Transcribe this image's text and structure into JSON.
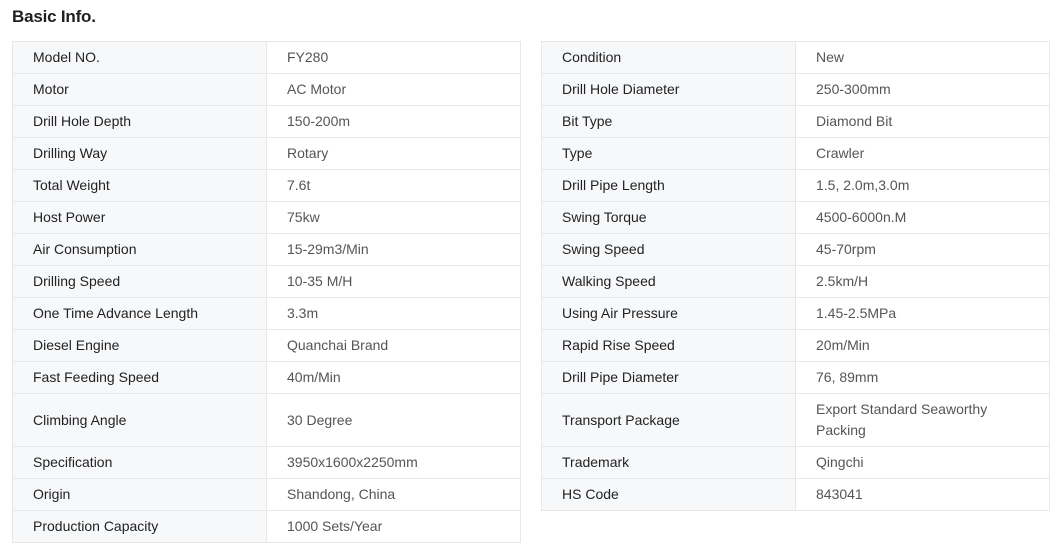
{
  "page": {
    "title": "Basic Info."
  },
  "left_table": {
    "rows": [
      {
        "label": "Model NO.",
        "value": "FY280"
      },
      {
        "label": "Motor",
        "value": "AC Motor"
      },
      {
        "label": "Drill Hole Depth",
        "value": "150-200m"
      },
      {
        "label": "Drilling Way",
        "value": "Rotary"
      },
      {
        "label": "Total Weight",
        "value": "7.6t"
      },
      {
        "label": "Host Power",
        "value": "75kw"
      },
      {
        "label": "Air Consumption",
        "value": "15-29m3/Min"
      },
      {
        "label": "Drilling Speed",
        "value": "10-35 M/H"
      },
      {
        "label": "One Time Advance Length",
        "value": "3.3m"
      },
      {
        "label": "Diesel Engine",
        "value": "Quanchai Brand"
      },
      {
        "label": "Fast Feeding Speed",
        "value": "40m/Min"
      },
      {
        "label": "Climbing Angle",
        "value": "30 Degree"
      },
      {
        "label": "Specification",
        "value": "3950x1600x2250mm"
      },
      {
        "label": "Origin",
        "value": "Shandong, China"
      },
      {
        "label": "Production Capacity",
        "value": "1000 Sets/Year"
      }
    ]
  },
  "right_table": {
    "rows": [
      {
        "label": "Condition",
        "value": "New"
      },
      {
        "label": "Drill Hole Diameter",
        "value": "250-300mm"
      },
      {
        "label": "Bit Type",
        "value": "Diamond Bit"
      },
      {
        "label": "Type",
        "value": "Crawler"
      },
      {
        "label": "Drill Pipe Length",
        "value": "1.5, 2.0m,3.0m"
      },
      {
        "label": "Swing Torque",
        "value": "4500-6000n.M"
      },
      {
        "label": "Swing Speed",
        "value": "45-70rpm"
      },
      {
        "label": "Walking Speed",
        "value": "2.5km/H"
      },
      {
        "label": "Using Air Pressure",
        "value": "1.45-2.5MPa"
      },
      {
        "label": "Rapid Rise Speed",
        "value": "20m/Min"
      },
      {
        "label": "Drill Pipe Diameter",
        "value": "76, 89mm"
      },
      {
        "label": "Transport Package",
        "value": "Export Standard Seaworthy Packing"
      },
      {
        "label": "Trademark",
        "value": "Qingchi"
      },
      {
        "label": "HS Code",
        "value": "843041"
      }
    ]
  }
}
